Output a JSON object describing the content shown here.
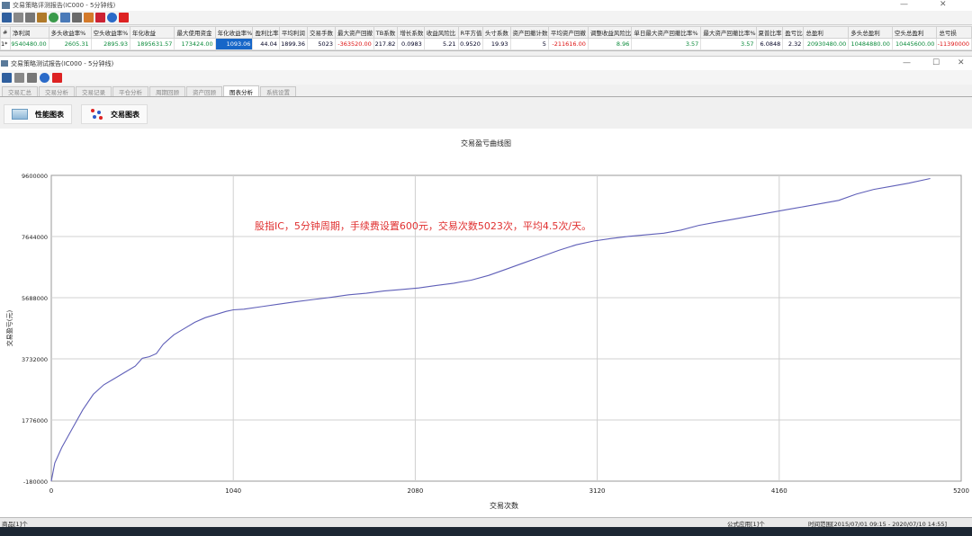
{
  "app": {
    "title": "交易策略评测报告(IC000 - 5分钟线)"
  },
  "stats": {
    "headers": [
      "#",
      "净利润",
      "多头收益率%",
      "空头收益率%",
      "年化收益",
      "最大使用资金",
      "年化收益率%",
      "盈利比率",
      "平均利润",
      "交易手数",
      "最大资产回撤",
      "TB系数",
      "增长系数",
      "收益风险比",
      "R平方值",
      "头寸系数",
      "资产回撤计数",
      "平均资产回撤",
      "调整收益风险比",
      "单日最大资产回撤比率%",
      "最大资产回撤比率%",
      "夏普比率",
      "盈亏比",
      "总盈利",
      "多头总盈利",
      "空头总盈利",
      "总亏损"
    ],
    "row": [
      "1*",
      "9540480.00",
      "2605.31",
      "2895.93",
      "1895631.57",
      "173424.00",
      "1093.06",
      "44.04",
      "1899.36",
      "5023",
      "-363520.00",
      "217.82",
      "0.0983",
      "5.21",
      "0.9520",
      "19.93",
      "5",
      "-211616.00",
      "8.96",
      "3.57",
      "3.57",
      "6.0848",
      "2.32",
      "20930480.00",
      "10484880.00",
      "10445600.00",
      "-11390000"
    ]
  },
  "inner_window": {
    "title": "交易策略测试报告(IC000 - 5分钟线)"
  },
  "tabs": [
    "交易汇总",
    "交易分析",
    "交易记录",
    "平仓分析",
    "周期回顾",
    "资产回顾",
    "图表分析",
    "系统设置"
  ],
  "subtabs": {
    "performance": "性能图表",
    "trades": "交易图表"
  },
  "chart_data": {
    "type": "line",
    "title": "交易盈亏曲线图",
    "xlabel": "交易次数",
    "ylabel": "交易盈亏(元)",
    "annotation": "股指IC，5分钟周期，手续费设置600元，交易次数5023次，平均4.5次/天。",
    "xlim": [
      0,
      5200
    ],
    "ylim": [
      -180000,
      9600000
    ],
    "x_ticks": [
      0,
      1040,
      2080,
      3120,
      4160,
      5200
    ],
    "y_ticks": [
      -180000,
      1776000,
      3732000,
      5688000,
      7644000,
      9600000
    ],
    "x_tick_labels": [
      "0",
      "1040",
      "2080",
      "3120",
      "4160",
      "5200"
    ],
    "y_tick_labels": [
      "-180000",
      "1776000",
      "3732000",
      "5688000",
      "7644000",
      "9600000"
    ],
    "grid": true,
    "series": [
      {
        "x": [
          0,
          20,
          60,
          120,
          180,
          240,
          300,
          360,
          420,
          480,
          520,
          560,
          600,
          640,
          700,
          760,
          820,
          880,
          940,
          1000,
          1040,
          1100,
          1200,
          1300,
          1400,
          1500,
          1600,
          1700,
          1800,
          1900,
          2000,
          2100,
          2200,
          2300,
          2400,
          2500,
          2600,
          2700,
          2800,
          2900,
          3000,
          3100,
          3200,
          3300,
          3400,
          3500,
          3600,
          3700,
          3800,
          3900,
          4000,
          4100,
          4200,
          4300,
          4400,
          4500,
          4600,
          4700,
          4800,
          4900,
          5023
        ],
        "y": [
          -180000,
          400000,
          900000,
          1500000,
          2100000,
          2600000,
          2900000,
          3100000,
          3300000,
          3500000,
          3750000,
          3800000,
          3900000,
          4200000,
          4500000,
          4700000,
          4900000,
          5050000,
          5150000,
          5250000,
          5300000,
          5320000,
          5400000,
          5480000,
          5560000,
          5630000,
          5700000,
          5780000,
          5830000,
          5900000,
          5950000,
          6000000,
          6080000,
          6150000,
          6250000,
          6400000,
          6600000,
          6800000,
          7000000,
          7200000,
          7380000,
          7500000,
          7580000,
          7650000,
          7700000,
          7750000,
          7850000,
          8000000,
          8100000,
          8200000,
          8300000,
          8400000,
          8500000,
          8600000,
          8700000,
          8800000,
          9000000,
          9150000,
          9250000,
          9350000,
          9500000
        ]
      }
    ]
  },
  "status": {
    "left": "商品[1]个",
    "formula": "公式应用[1]个",
    "range": "时间范围[2015/07/01 09:15 - 2020/07/10 14:55]"
  }
}
